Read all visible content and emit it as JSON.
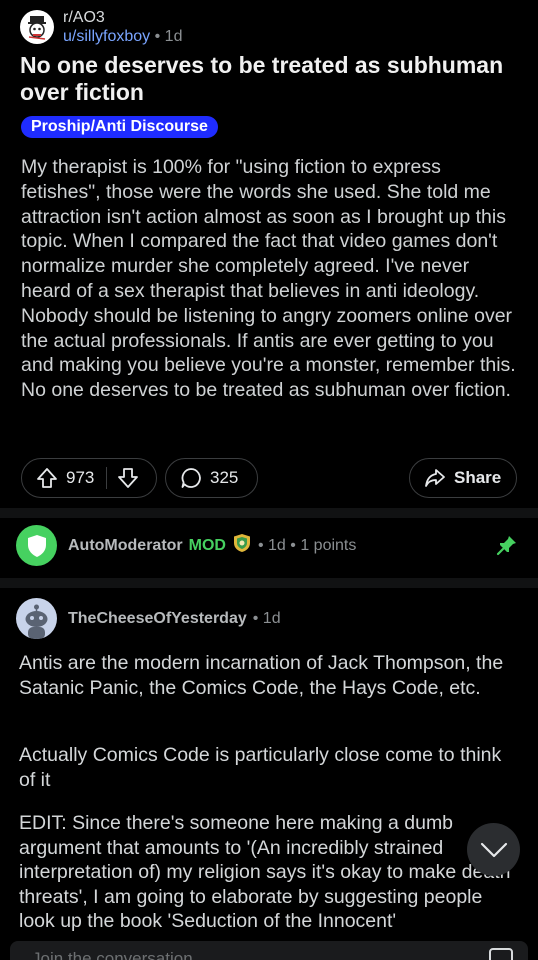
{
  "post": {
    "subreddit": "r/AO3",
    "username": "u/sillyfoxboy",
    "dot": "•",
    "age": "1d",
    "title": "No one deserves to be treated as subhuman over fiction",
    "flair": "Proship/Anti Discourse",
    "body": "My therapist is 100% for \"using fiction to express fetishes\", those were the words she used. She told me attraction isn't action almost as soon as I brought up this topic. When I compared the fact that video games don't normalize murder she completely agreed. I've never heard of a sex therapist that believes in anti ideology. Nobody should be listening to angry zoomers online over the actual professionals. If antis are ever getting to you and making you believe you're a monster, remember this. No one deserves to be treated as subhuman over fiction.",
    "upvotes": "973",
    "comments": "325",
    "share_label": "Share"
  },
  "automod": {
    "name": "AutoModerator",
    "badge": "MOD",
    "meta": "• 1d • 1 points"
  },
  "comment": {
    "name": "TheCheeseOfYesterday",
    "meta": "• 1d",
    "p1": "Antis are the modern incarnation of Jack Thompson, the Satanic Panic, the Comics Code, the Hays Code, etc.",
    "p2": "Actually Comics Code is particularly close come to think of it",
    "p3": "EDIT: Since there's someone here making a dumb argument that amounts to '(An incredibly strained interpretation of) my religion says it's okay to make death threats', I am going to elaborate by suggesting people look up the book 'Seduction of the Innocent'"
  },
  "reply": {
    "placeholder": "Join the conversation"
  },
  "colors": {
    "background": "#000000",
    "flair": "#1f2cff",
    "mod_green": "#46d160",
    "username_link": "#7aa5ff"
  },
  "icons": [
    "subreddit-avatar-icon",
    "upvote-icon",
    "downvote-icon",
    "comment-icon",
    "share-icon",
    "shield-icon",
    "pin-icon",
    "snoo-avatar-icon",
    "chevron-down-icon",
    "image-icon"
  ]
}
